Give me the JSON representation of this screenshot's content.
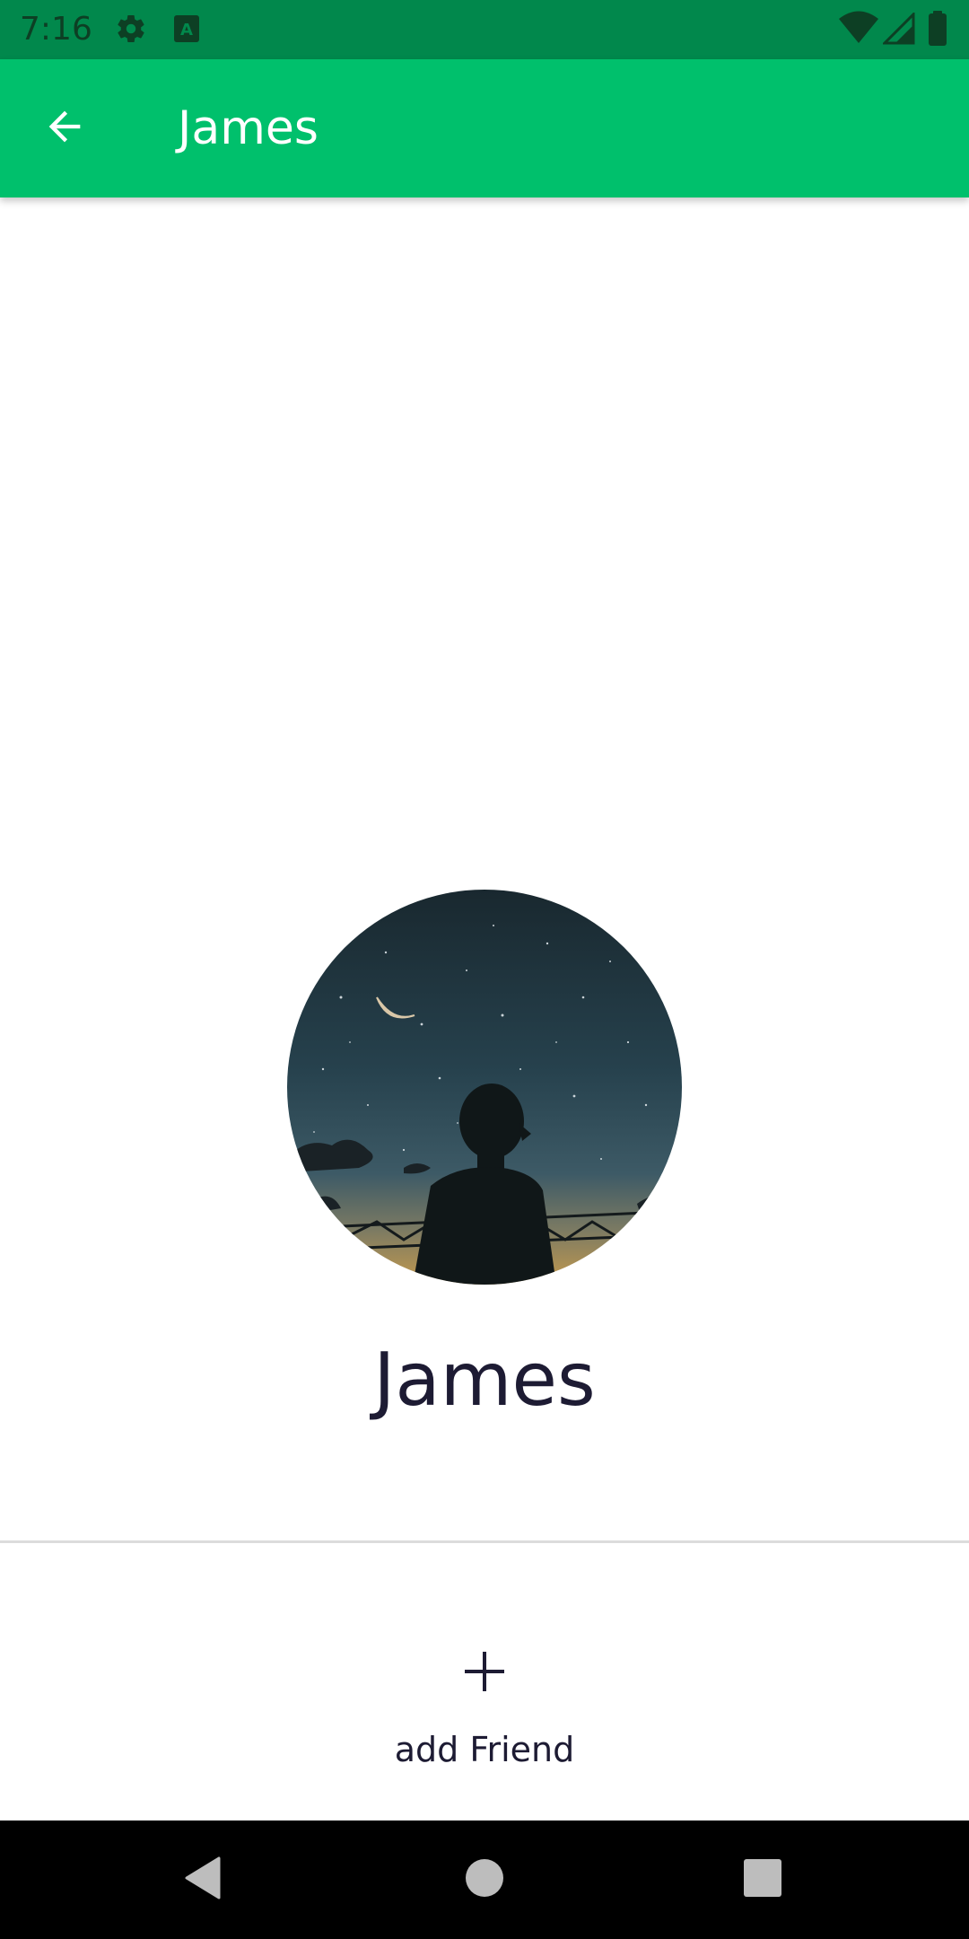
{
  "status_bar": {
    "time": "7:16",
    "icons": [
      "gear-icon",
      "keyboard-a-icon",
      "wifi-icon",
      "cell-signal-icon",
      "battery-icon"
    ]
  },
  "app_bar": {
    "back_icon": "arrow-back-icon",
    "title": "James",
    "color": "#00c06c"
  },
  "profile": {
    "name": "James",
    "avatar": "night-sky-silhouette-photo"
  },
  "actions": {
    "add_icon": "plus-icon",
    "add_friend_label": "add Friend"
  },
  "nav_bar": {
    "icons": [
      "back-triangle-icon",
      "home-circle-icon",
      "recents-square-icon"
    ]
  },
  "colors": {
    "status_bar": "#01884c",
    "accent": "#00c06c",
    "text_dark": "#1d1b33"
  }
}
